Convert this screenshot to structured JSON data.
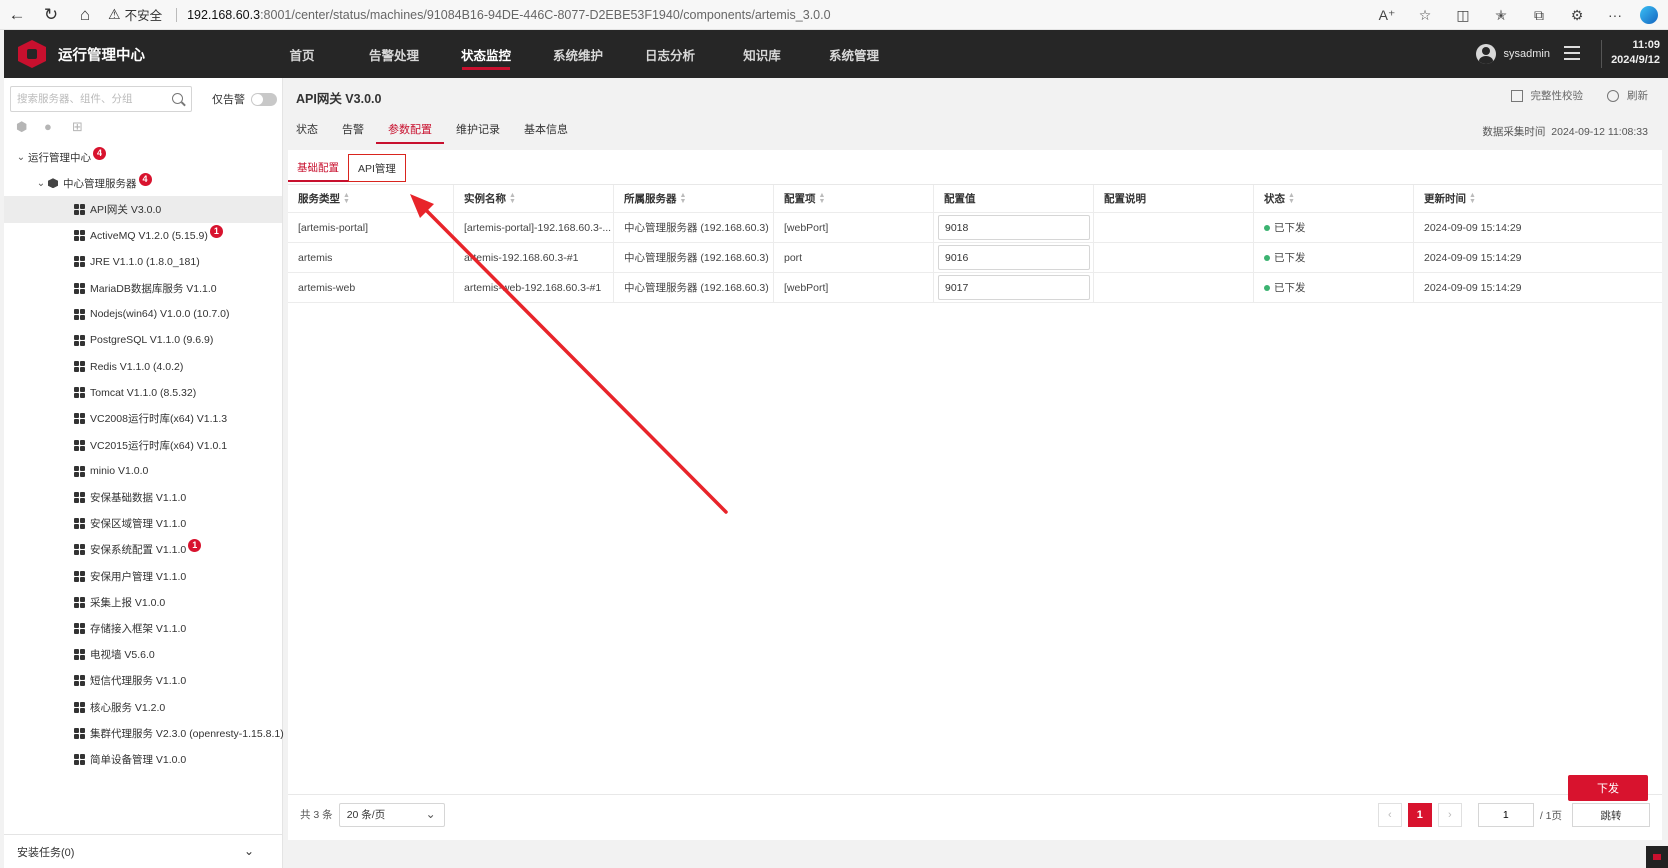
{
  "browser": {
    "insecure_label": "不安全",
    "url_host": "192.168.60.3",
    "url_path": ":8001/center/status/machines/91084B16-94DE-446C-8077-D2EBE53F1940/components/artemis_3.0.0"
  },
  "header": {
    "app_title": "运行管理中心",
    "nav": [
      "首页",
      "告警处理",
      "状态监控",
      "系统维护",
      "日志分析",
      "知识库",
      "系统管理"
    ],
    "active_nav": "状态监控",
    "username": "sysadmin",
    "time": "11:09",
    "date": "2024/9/12"
  },
  "sidebar": {
    "search_placeholder": "搜索服务器、组件、分组",
    "only_alarm_label": "仅告警",
    "root": {
      "label": "运行管理中心",
      "badge": "4"
    },
    "server": {
      "label": "中心管理服务器",
      "badge": "4"
    },
    "components": [
      {
        "label": "API网关 V3.0.0",
        "selected": true
      },
      {
        "label": "ActiveMQ V1.2.0 (5.15.9)",
        "badge": "1"
      },
      {
        "label": "JRE V1.1.0 (1.8.0_181)"
      },
      {
        "label": "MariaDB数据库服务 V1.1.0"
      },
      {
        "label": "Nodejs(win64) V1.0.0 (10.7.0)"
      },
      {
        "label": "PostgreSQL V1.1.0 (9.6.9)"
      },
      {
        "label": "Redis V1.1.0 (4.0.2)"
      },
      {
        "label": "Tomcat V1.1.0 (8.5.32)"
      },
      {
        "label": "VC2008运行时库(x64) V1.1.3"
      },
      {
        "label": "VC2015运行时库(x64) V1.0.1"
      },
      {
        "label": "minio V1.0.0"
      },
      {
        "label": "安保基础数据 V1.1.0"
      },
      {
        "label": "安保区域管理 V1.1.0"
      },
      {
        "label": "安保系统配置 V1.1.0",
        "badge": "1"
      },
      {
        "label": "安保用户管理 V1.1.0"
      },
      {
        "label": "采集上报 V1.0.0"
      },
      {
        "label": "存储接入框架 V1.1.0"
      },
      {
        "label": "电视墙 V5.6.0"
      },
      {
        "label": "短信代理服务 V1.1.0"
      },
      {
        "label": "核心服务 V1.2.0"
      },
      {
        "label": "集群代理服务 V2.3.0 (openresty-1.15.8.1)"
      },
      {
        "label": "简单设备管理 V1.0.0"
      }
    ],
    "install_tasks": "安装任务(0)"
  },
  "main": {
    "title": "API网关 V3.0.0",
    "integrity_check": "完整性校验",
    "refresh": "刷新",
    "collect_label": "数据采集时间",
    "collect_time": "2024-09-12 11:08:33",
    "tabs": [
      "状态",
      "告警",
      "参数配置",
      "维护记录",
      "基本信息"
    ],
    "active_tab": "参数配置",
    "subtabs": [
      "基础配置",
      "API管理"
    ],
    "active_subtab": "基础配置",
    "table": {
      "columns": [
        "服务类型",
        "实例名称",
        "所属服务器",
        "配置项",
        "配置值",
        "配置说明",
        "状态",
        "更新时间"
      ],
      "rows": [
        {
          "service_type": "[artemis-portal]",
          "instance": "[artemis-portal]-192.168.60.3-...",
          "server": "中心管理服务器 (192.168.60.3)",
          "item": "[webPort]",
          "value": "9018",
          "desc": "",
          "status": "已下发",
          "updated": "2024-09-09 15:14:29"
        },
        {
          "service_type": "artemis",
          "instance": "artemis-192.168.60.3-#1",
          "server": "中心管理服务器 (192.168.60.3)",
          "item": "port",
          "value": "9016",
          "desc": "",
          "status": "已下发",
          "updated": "2024-09-09 15:14:29"
        },
        {
          "service_type": "artemis-web",
          "instance": "artemis-web-192.168.60.3-#1",
          "server": "中心管理服务器 (192.168.60.3)",
          "item": "[webPort]",
          "value": "9017",
          "desc": "",
          "status": "已下发",
          "updated": "2024-09-09 15:14:29"
        }
      ]
    },
    "pagination": {
      "total": "共 3 条",
      "page_size": "20 条/页",
      "current": "1",
      "page_input": "1",
      "total_pages": "/ 1页",
      "jump": "跳转"
    },
    "dispatch_button": "下发"
  },
  "colors": {
    "accent": "#c8102e",
    "header_bg": "#262626",
    "status_ok": "#3cb371",
    "annotation": "#e8242a"
  }
}
